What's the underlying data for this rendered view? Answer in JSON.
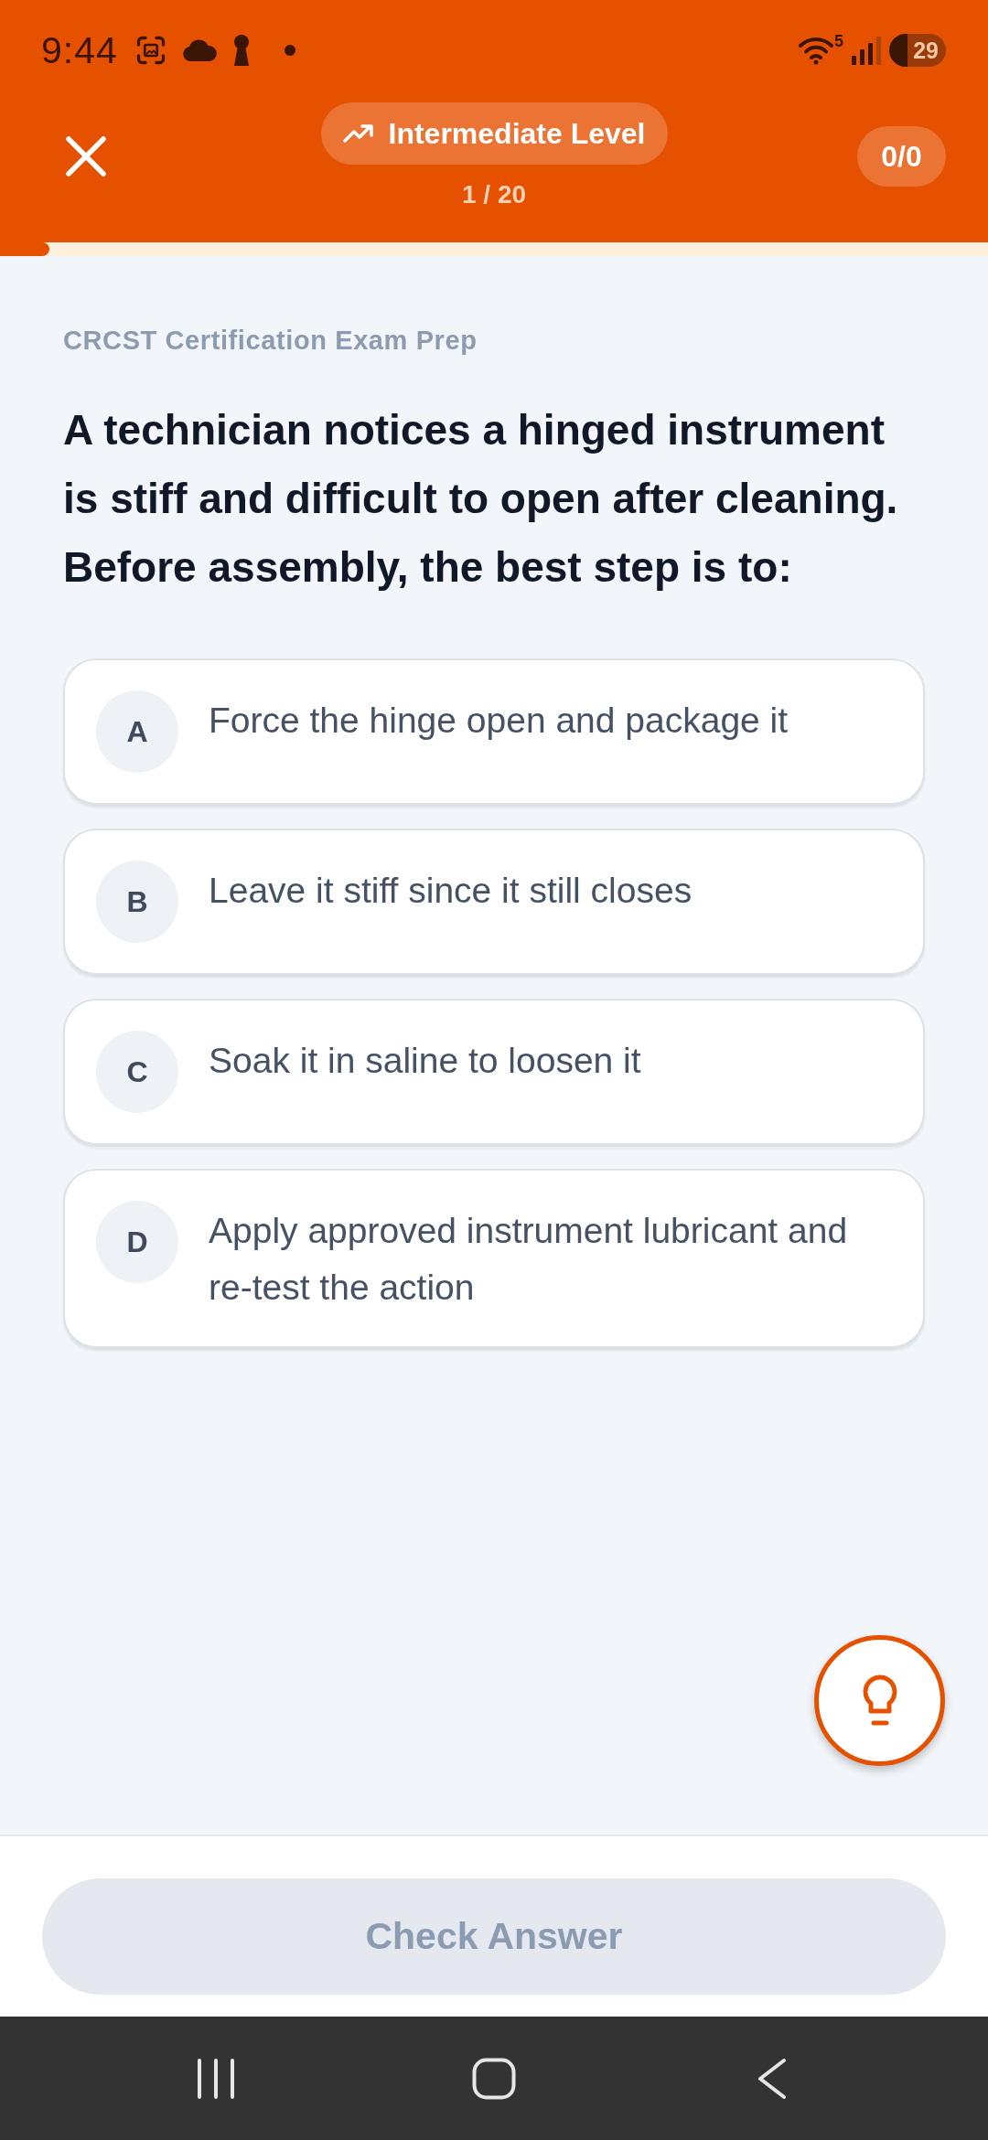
{
  "status_bar": {
    "time": "9:44",
    "wifi_band": "5",
    "battery": "29"
  },
  "header": {
    "level_label": "Intermediate Level",
    "question_counter": "1 / 20",
    "score": "0/0"
  },
  "progress": {
    "level": 0.05
  },
  "exam_title": "CRCST Certification Exam Prep",
  "question": "A technician notices a hinged instrument is stiff and difficult to open after cleaning. Before assembly, the best step is to:",
  "options": [
    {
      "letter": "A",
      "text": "Force the hinge open and package it",
      "selected": false
    },
    {
      "letter": "B",
      "text": "Leave it stiff since it still closes",
      "selected": false
    },
    {
      "letter": "C",
      "text": "Soak it in saline to loosen it",
      "selected": false
    },
    {
      "letter": "D",
      "text": "Apply approved instrument lubricant and re-test the action",
      "selected": false
    }
  ],
  "check_button": {
    "label": "Check Answer",
    "disabled": true
  }
}
